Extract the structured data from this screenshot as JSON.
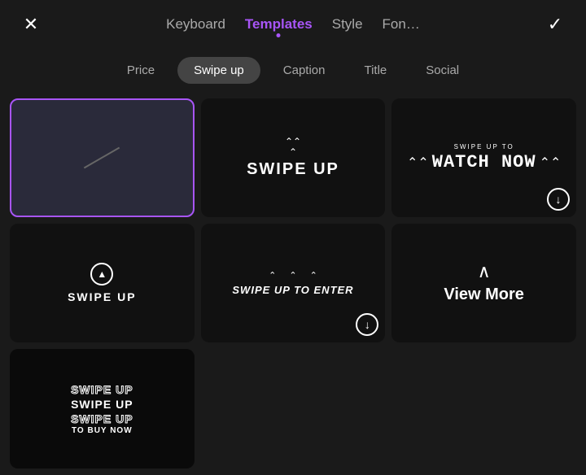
{
  "nav": {
    "close_icon": "✕",
    "check_icon": "✓",
    "items": [
      {
        "id": "keyboard",
        "label": "Keyboard",
        "active": false
      },
      {
        "id": "templates",
        "label": "Templates",
        "active": true
      },
      {
        "id": "style",
        "label": "Style",
        "active": false
      },
      {
        "id": "font",
        "label": "Fon…",
        "active": false
      }
    ]
  },
  "categories": [
    {
      "id": "price",
      "label": "Price",
      "selected": false
    },
    {
      "id": "swipe-up",
      "label": "Swipe up",
      "selected": true
    },
    {
      "id": "caption",
      "label": "Caption",
      "selected": false
    },
    {
      "id": "title",
      "label": "Title",
      "selected": false
    },
    {
      "id": "social",
      "label": "Social",
      "selected": false
    }
  ],
  "templates": [
    {
      "id": "empty",
      "type": "empty",
      "selected": true
    },
    {
      "id": "swipe-up-bold",
      "type": "swipe-up-bold",
      "label": "SWIPE UP",
      "selected": false
    },
    {
      "id": "watch-now",
      "type": "watch-now",
      "sub": "SWIPE UP TO",
      "main": "WATCH NOW",
      "selected": false,
      "download": true
    },
    {
      "id": "swipe-circle",
      "type": "swipe-circle",
      "label": "SWIPE UP",
      "selected": false
    },
    {
      "id": "swipe-enter",
      "type": "swipe-enter",
      "label": "SWIPE UP TO ENTER",
      "selected": false,
      "download": true
    },
    {
      "id": "view-more",
      "type": "view-more",
      "label": "View More",
      "selected": false
    },
    {
      "id": "swipe-stacked",
      "type": "swipe-stacked",
      "lines": [
        "SWIPE UP",
        "SWIPE UP",
        "SWIPE UP",
        "TO BUY NOW"
      ],
      "selected": false
    }
  ],
  "colors": {
    "accent": "#a855f7",
    "bg": "#1a1a1a",
    "card_bg": "#000",
    "selected_border": "#a855f7"
  }
}
